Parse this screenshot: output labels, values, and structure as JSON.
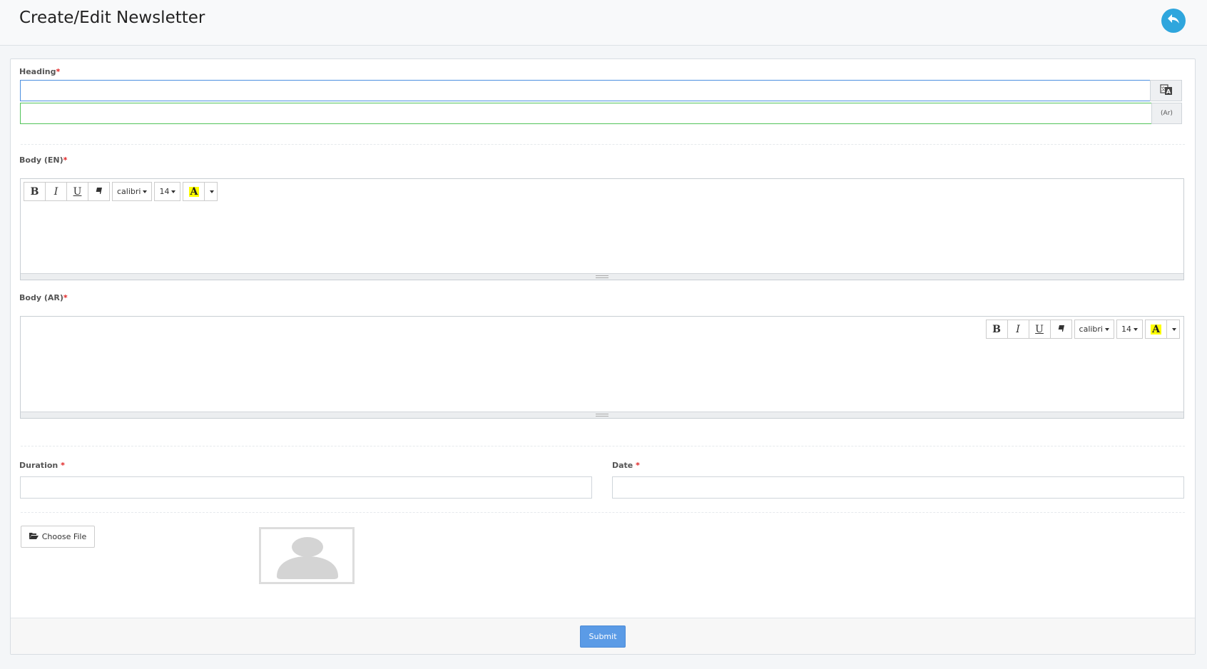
{
  "header": {
    "title": "Create/Edit Newsletter",
    "back_icon": "reply-icon",
    "back_color": "#2fa6dd"
  },
  "form": {
    "heading": {
      "label": "Heading",
      "required": "*",
      "value_en": "",
      "value_ar": "",
      "translate_icon": "translate-icon",
      "ar_addon": "(Ar)"
    },
    "body_en": {
      "label": "Body (EN)",
      "required": "*",
      "toolbar": {
        "bold": "B",
        "italic": "I",
        "underline": "U",
        "font": "calibri",
        "size": "14",
        "color": "A"
      }
    },
    "body_ar": {
      "label": "Body (AR)",
      "required": "*",
      "toolbar": {
        "bold": "B",
        "italic": "I",
        "underline": "U",
        "font": "calibri",
        "size": "14",
        "color": "A"
      }
    },
    "duration": {
      "label": "Duration ",
      "required": "*",
      "value": ""
    },
    "date": {
      "label": "Date ",
      "required": "*",
      "value": ""
    },
    "file": {
      "button_label": "Choose File",
      "icon": "folder-open-icon",
      "placeholder_icon": "user-avatar-icon"
    }
  },
  "footer": {
    "submit_label": "Submit",
    "submit_color": "#5b9be6"
  }
}
